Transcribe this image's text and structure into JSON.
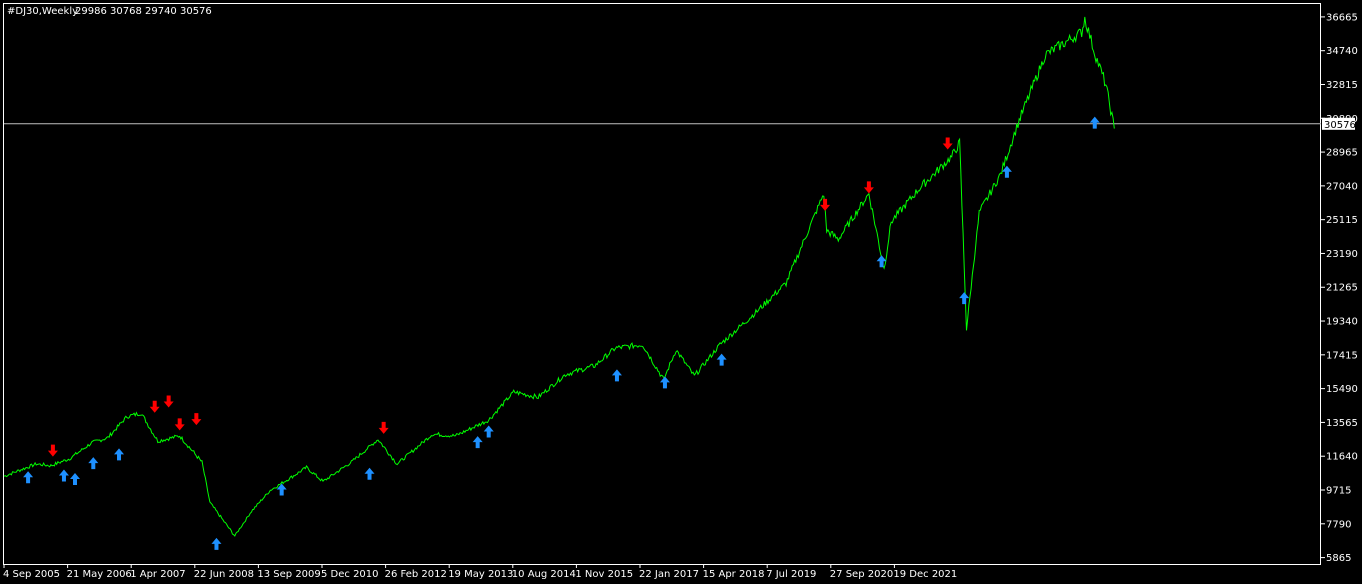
{
  "header": {
    "symbol": "#DJ30,Weekly",
    "ohlc": "29986 30768 29740 30576"
  },
  "price_label": "30576",
  "colors": {
    "background": "#000000",
    "frame": "#ffffff",
    "price_line": "#00ff00",
    "buy_arrow": "#1e90ff",
    "sell_arrow": "#ff0000",
    "current_price_line": "#c0c0c0"
  },
  "chart_data": {
    "type": "line",
    "title": "#DJ30,Weekly",
    "ylim": [
      5500,
      37400
    ],
    "y_ticks": [
      5865,
      7790,
      9715,
      11640,
      13565,
      15490,
      17415,
      19340,
      21265,
      23190,
      25115,
      27040,
      28965,
      30890,
      32815,
      34740,
      36665
    ],
    "x_ticks": [
      "4 Sep 2005",
      "21 May 2006",
      "1 Apr 2007",
      "22 Jun 2008",
      "13 Sep 2009",
      "5 Dec 2010",
      "26 Feb 2012",
      "19 May 2013",
      "10 Aug 2014",
      "1 Nov 2015",
      "22 Jan 2017",
      "15 Apr 2018",
      "7 Jul 2019",
      "27 Sep 2020",
      "19 Dec 2021"
    ],
    "current_price": 30576,
    "series": [
      {
        "x": [
          "2005-09-04",
          "2005-12-01",
          "2006-03-01",
          "2006-05-21",
          "2006-09-01",
          "2007-01-01",
          "2007-04-01",
          "2007-07-15",
          "2007-10-01",
          "2008-01-01",
          "2008-05-01",
          "2008-09-01",
          "2008-10-15",
          "2009-03-01",
          "2009-06-01",
          "2009-09-13",
          "2010-01-01",
          "2010-04-01",
          "2010-07-01",
          "2010-12-05",
          "2011-05-01",
          "2011-08-15",
          "2012-02-26",
          "2012-07-01",
          "2013-01-01",
          "2013-05-19",
          "2013-10-01",
          "2014-03-01",
          "2014-08-10",
          "2014-12-01",
          "2015-05-01",
          "2015-08-25",
          "2015-11-01",
          "2016-02-10",
          "2016-07-01",
          "2017-01-22",
          "2017-07-01",
          "2018-01-25",
          "2018-02-10",
          "2018-04-15",
          "2018-10-01",
          "2018-12-24",
          "2019-02-01",
          "2019-07-07",
          "2020-01-01",
          "2020-02-14",
          "2020-03-23",
          "2020-06-01",
          "2020-09-27",
          "2021-01-01",
          "2021-06-01",
          "2021-12-19",
          "2022-01-05",
          "2022-03-01",
          "2022-05-01",
          "2022-06-17"
        ],
        "y": [
          10500,
          10850,
          11200,
          11100,
          11500,
          12400,
          12700,
          13900,
          14100,
          12500,
          12800,
          11300,
          9000,
          7100,
          8500,
          9700,
          10400,
          11000,
          10200,
          11300,
          12600,
          11200,
          12900,
          12800,
          13700,
          15300,
          15000,
          16300,
          16800,
          17800,
          18000,
          16000,
          17700,
          16200,
          18000,
          19900,
          21500,
          26600,
          24500,
          24000,
          26600,
          22300,
          25000,
          26900,
          28700,
          29500,
          18900,
          25500,
          27700,
          30600,
          34500,
          35800,
          36600,
          34600,
          32800,
          30300
        ]
      }
    ],
    "buy_signals": {
      "x": [
        "2006-01-15",
        "2006-08-01",
        "2006-10-01",
        "2007-01-10",
        "2007-06-01",
        "2008-11-20",
        "2009-11-15",
        "2011-03-15",
        "2012-11-01",
        "2013-01-01",
        "2014-12-10",
        "2015-09-01",
        "2016-07-10",
        "2018-12-10",
        "2020-03-10",
        "2020-11-01",
        "2022-03-01"
      ],
      "y": [
        10900,
        11000,
        10800,
        11700,
        12200,
        7100,
        10200,
        11100,
        12900,
        13500,
        16700,
        16300,
        17600,
        23200,
        21100,
        28300,
        31100
      ]
    },
    "sell_signals": {
      "x": [
        "2006-06-01",
        "2007-12-15",
        "2008-03-01",
        "2008-05-01",
        "2008-08-01",
        "2011-06-01",
        "2018-02-01",
        "2018-10-01",
        "2019-12-10"
      ],
      "y": [
        11500,
        14000,
        14300,
        13000,
        13300,
        12800,
        25500,
        26500,
        29000
      ]
    }
  }
}
